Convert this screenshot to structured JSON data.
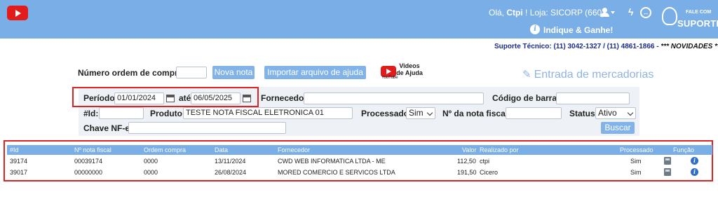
{
  "header": {
    "greeting_prefix": "Olá,",
    "user": "Ctpi",
    "loja": "! Loja: SICORP (660)",
    "indique": "Indique & Ganhe!",
    "fale_com": "FALE COM",
    "suporte": "SUPORTE"
  },
  "support_line": {
    "text": "Suporte Técnico: (11) 3042-1327 / (11) 4861-1866 - ",
    "novidades": "*** NOVIDADES ***"
  },
  "top_form": {
    "ordem_label": "Número ordem de compra:",
    "ordem_value": "",
    "nova_nota": "Nova nota",
    "importar": "Importar arquivo de ajuda",
    "videos_line1": "Videos",
    "videos_line2": "de Ajuda",
    "youtube": "YouTube",
    "page_title": "Entrada de mercadorias"
  },
  "filters": {
    "periodo_label": "Período:",
    "periodo_from": "01/01/2024",
    "ate_label": "até",
    "periodo_to": "06/05/2025",
    "fornecedor_label": "Fornecedor:",
    "fornecedor_value": "",
    "codigo_label": "Código de barras:",
    "codigo_value": "",
    "id_label": "#Id:",
    "id_value": "",
    "produto_label": "Produto:",
    "produto_value": "TESTE NOTA FISCAL ELETRONICA 01",
    "processado_label": "Processado:",
    "processado_value": "Sim",
    "nf_label": "Nº da nota fiscal:",
    "nf_value": "",
    "status_label": "Status:",
    "status_value": "Ativo",
    "chave_label": "Chave NF-e:",
    "chave_value": "",
    "buscar": "Buscar"
  },
  "table": {
    "headers": [
      "#Id",
      "Nº nota fiscal",
      "Ordem compra",
      "Data",
      "Fornecedor",
      "Valor",
      "Realizado por",
      "Processado",
      "Função"
    ],
    "rows": [
      [
        "39174",
        "00039174",
        "0000",
        "13/11/2024",
        "CWD WEB INFORMATICA LTDA - ME",
        "112,50",
        "ctpi",
        "Sim"
      ],
      [
        "39017",
        "00000000",
        "0000",
        "26/08/2024",
        "MORED COMERCIO E SERVICOS LTDA",
        "191,50",
        "Cicero",
        "Sim"
      ]
    ]
  },
  "colors": {
    "header_blue": "#7aaee6",
    "button_blue": "#82b3e8",
    "highlight_red": "#e02222",
    "support_text": "#1a2b8a"
  },
  "icons": [
    "youtube-icon",
    "user-icon",
    "bolt-icon",
    "swap-icon",
    "info-icon",
    "headset-icon",
    "pencil-square-icon",
    "calendar-icon",
    "print-icon"
  ]
}
